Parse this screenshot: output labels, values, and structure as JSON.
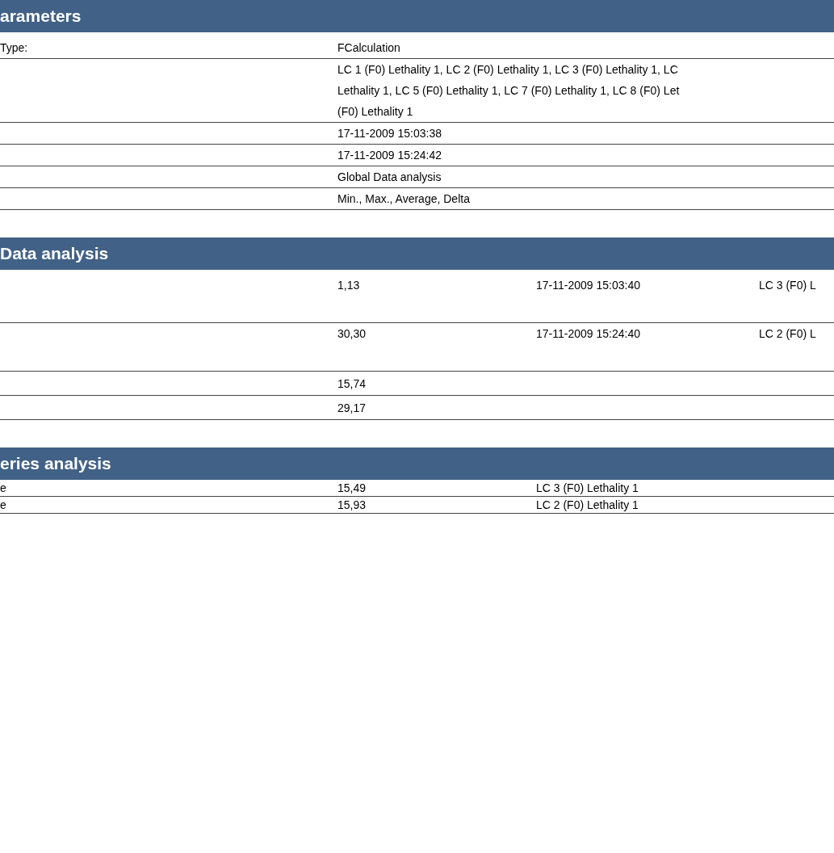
{
  "sections": [
    {
      "title": "arameters",
      "kind": "params",
      "rows": [
        {
          "label": "Type:",
          "lines": [
            "FCalculation"
          ]
        },
        {
          "label": "",
          "lines": [
            "LC 1 (F0) Lethality 1, LC 2 (F0) Lethality 1, LC 3 (F0) Lethality 1, LC",
            "Lethality 1, LC 5 (F0) Lethality 1, LC 7 (F0) Lethality 1, LC 8 (F0) Let",
            "(F0) Lethality 1"
          ]
        },
        {
          "label": "",
          "lines": [
            "17-11-2009 15:03:38"
          ]
        },
        {
          "label": "",
          "lines": [
            "17-11-2009 15:24:42"
          ]
        },
        {
          "label": "",
          "lines": [
            "Global Data analysis"
          ]
        },
        {
          "label": "",
          "lines": [
            "Min., Max., Average, Delta"
          ]
        }
      ]
    },
    {
      "title": "Data analysis",
      "kind": "data",
      "rows": [
        {
          "label": "",
          "cells": [
            "1,13",
            "17-11-2009 15:03:40",
            "LC 3 (F0) L"
          ]
        },
        {
          "label": "",
          "cells": [
            "30,30",
            "17-11-2009 15:24:40",
            "LC 2 (F0) L"
          ]
        },
        {
          "label": "",
          "cells": [
            "15,74"
          ]
        },
        {
          "label": "",
          "cells": [
            "29,17"
          ]
        }
      ]
    },
    {
      "title": "eries analysis",
      "kind": "series",
      "rows": [
        {
          "label": "e",
          "cells": [
            "15,49",
            "LC 3 (F0) Lethality 1"
          ]
        },
        {
          "label": "e",
          "cells": [
            "15,93",
            "LC 2 (F0) Lethality 1"
          ]
        }
      ]
    }
  ]
}
